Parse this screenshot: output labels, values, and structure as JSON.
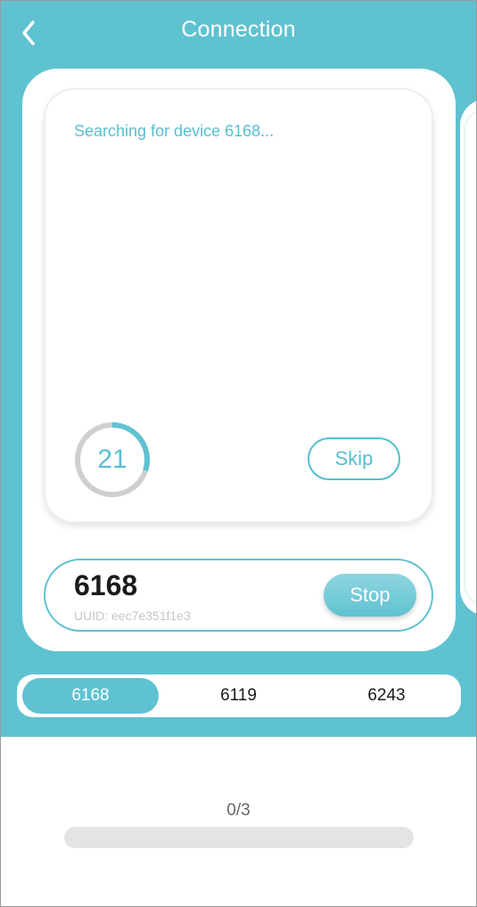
{
  "header": {
    "title": "Connection"
  },
  "search": {
    "status": "Searching for device 6168...",
    "countdown": "21",
    "countdown_progress": 0.3,
    "skip_label": "Skip"
  },
  "device": {
    "name": "6168",
    "uuid": "UUID: eec7e351f1e3",
    "stop_label": "Stop"
  },
  "device_tabs": [
    {
      "label": "6168",
      "active": true
    },
    {
      "label": "6119",
      "active": false
    },
    {
      "label": "6243",
      "active": false
    }
  ],
  "progress": {
    "text": "0/3",
    "value": 0
  },
  "colors": {
    "accent": "#5fc2d1",
    "ring_track": "#cfcfcf"
  },
  "icons": {
    "back": "chevron-left-icon"
  }
}
